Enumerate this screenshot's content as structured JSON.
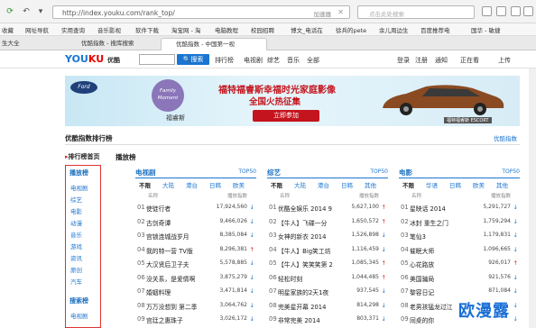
{
  "browser": {
    "url": "http://index.youku.com/rank_top/",
    "accelerate": "加速器",
    "search_placeholder": "点击此处搜索"
  },
  "favorites": [
    "收藏",
    "网址导航",
    "实用查询",
    "音乐影视",
    "软件下载",
    "淘宝网 - 淘",
    "电脑教程",
    "校园招聘",
    "博文_电话在",
    "徐兵的pete",
    "余儿周边生",
    "百度推荐电",
    "国华 - 敏捷"
  ],
  "tabs": [
    {
      "label": "优酷指数 - 搜库搜索",
      "active": false
    },
    {
      "label": "优酷指数 - 中国第一视",
      "active": true
    }
  ],
  "tab_left": "生大全",
  "youku": {
    "logo_a": "YOU",
    "logo_b": "KU",
    "logo_c": "优酷",
    "search_btn": "搜索",
    "nav": [
      "排行榜",
      "电视剧",
      "综艺",
      "音乐",
      "全部"
    ],
    "right_nav": [
      "登录",
      "注册",
      "通知",
      "正在看",
      "上传"
    ]
  },
  "banner": {
    "brand": "Ford",
    "family": "Family Moment",
    "family_cn": "福睿斯",
    "line1": "福特福睿斯幸福时光家庭影像",
    "line2": "全国火热征集",
    "button": "立即参加",
    "car": "福特福睿斯 ESCORT"
  },
  "page": {
    "title": "优酷指数排行榜",
    "index_link": "优酷指数",
    "sidebar_home": "排行榜首页",
    "section": "播放榜"
  },
  "sidebar": {
    "head1": "播放榜",
    "items": [
      "电视剧",
      "综艺",
      "电影",
      "动漫",
      "音乐",
      "游戏",
      "资讯",
      "原创",
      "汽车"
    ],
    "head2": "搜索榜",
    "items2": [
      "电视剧"
    ]
  },
  "columns": [
    {
      "title": "电视剧",
      "top50": "TOP50",
      "filters": [
        "不限",
        "大陆",
        "港台",
        "日韩",
        "欧美"
      ],
      "hdr_name": "名称",
      "hdr_num": "播放指数",
      "rows": [
        {
          "rank": "01",
          "name": "使徒行者",
          "num": "17,924,560",
          "trend": "down"
        },
        {
          "rank": "02",
          "name": "古剑奇谭",
          "num": "9,466,026",
          "trend": "down"
        },
        {
          "rank": "03",
          "name": "宫锁连城战岁月",
          "num": "8,385,084",
          "trend": "down"
        },
        {
          "rank": "04",
          "name": "我的特一营 TV版",
          "num": "8,296,381",
          "trend": "up"
        },
        {
          "rank": "05",
          "name": "大汉贤后卫子夫",
          "num": "5,578,885",
          "trend": "down"
        },
        {
          "rank": "06",
          "name": "没关系，是爱情啊",
          "num": "3,875,279",
          "trend": "down"
        },
        {
          "rank": "07",
          "name": "婚姻料理",
          "num": "3,471,814",
          "trend": "down"
        },
        {
          "rank": "08",
          "name": "万万没想到 第二季",
          "num": "3,064,762",
          "trend": "down"
        },
        {
          "rank": "09",
          "name": "宫廷之惠珠子",
          "num": "3,026,172",
          "trend": "down"
        }
      ]
    },
    {
      "title": "综艺",
      "top50": "TOP50",
      "filters": [
        "不限",
        "大陆",
        "港台",
        "日韩",
        "其他"
      ],
      "hdr_name": "名称",
      "hdr_num": "播放指数",
      "rows": [
        {
          "rank": "01",
          "name": "优酷全娱乐 2014 9",
          "num": "5,627,100",
          "trend": "up"
        },
        {
          "rank": "02",
          "name": "【牛人】飞碟一分",
          "num": "1,650,572",
          "trend": "up"
        },
        {
          "rank": "03",
          "name": "女神的新衣 2014",
          "num": "1,526,898",
          "trend": "down"
        },
        {
          "rank": "04",
          "name": "【牛人】Big笑工坊",
          "num": "1,116,459",
          "trend": "down"
        },
        {
          "rank": "05",
          "name": "【牛人】笑笑笑第 2",
          "num": "1,085,345",
          "trend": "up"
        },
        {
          "rank": "06",
          "name": "轻松时刻",
          "num": "1,044,485",
          "trend": "up"
        },
        {
          "rank": "07",
          "name": "明星家族的2天1夜",
          "num": "937,545",
          "trend": "down"
        },
        {
          "rank": "08",
          "name": "完美星开幕 2014",
          "num": "814,298",
          "trend": "down"
        },
        {
          "rank": "09",
          "name": "非常完美 2014",
          "num": "803,371",
          "trend": "down"
        }
      ]
    },
    {
      "title": "电影",
      "top50": "TOP50",
      "filters": [
        "不限",
        "华语",
        "日韩",
        "欧美",
        "其他"
      ],
      "hdr_name": "名称",
      "hdr_num": "播放指数",
      "rows": [
        {
          "rank": "01",
          "name": "星映话 2014",
          "num": "5,291,727",
          "trend": "down"
        },
        {
          "rank": "02",
          "name": "冰封 重生之门",
          "num": "1,759,294",
          "trend": "down"
        },
        {
          "rank": "03",
          "name": "笔仙3",
          "num": "1,179,831",
          "trend": "down"
        },
        {
          "rank": "04",
          "name": "催眠大师",
          "num": "1,096,665",
          "trend": "down"
        },
        {
          "rank": "05",
          "name": "心花路放",
          "num": "926,017",
          "trend": "up"
        },
        {
          "rank": "06",
          "name": "美国骗局",
          "num": "921,576",
          "trend": "down"
        },
        {
          "rank": "07",
          "name": "黎容日记",
          "num": "871,084",
          "trend": "down"
        },
        {
          "rank": "08",
          "name": "老男孩猛龙过江",
          "num": "",
          "trend": "down"
        },
        {
          "rank": "09",
          "name": "同桌的你",
          "num": "",
          "trend": "down"
        }
      ]
    }
  ],
  "watermark": "欧漫露",
  "colors": {
    "accent": "#1a75d2",
    "red": "#c4141d"
  }
}
